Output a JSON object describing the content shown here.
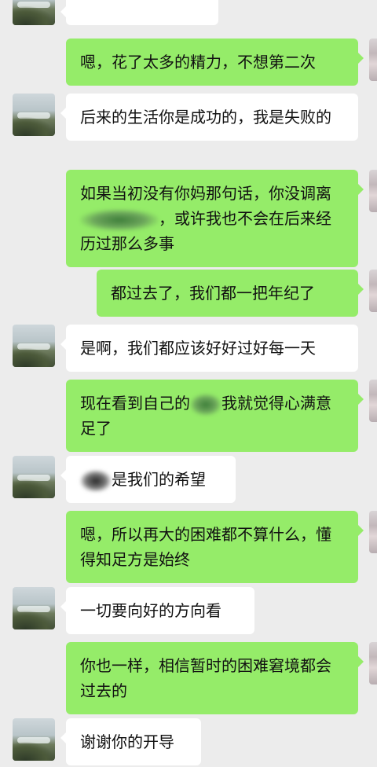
{
  "messages": [
    {
      "side": "in",
      "text": ""
    },
    {
      "side": "out",
      "text": "嗯，花了太多的精力，不想第二次"
    },
    {
      "side": "in",
      "text": "后来的生活你是成功的，我是失败的"
    },
    {
      "side": "out",
      "text_a": "如果当初没有你妈那句话，你没调离",
      "text_b": "，或许我也不会在后来经历过那么多事",
      "redacted": true
    },
    {
      "side": "out",
      "text": "都过去了，我们都一把年纪了"
    },
    {
      "side": "in",
      "text": "是啊，我们都应该好好过好每一天"
    },
    {
      "side": "out",
      "text_a": "现在看到自己的",
      "text_b": "我就觉得心满意足了",
      "redacted": true
    },
    {
      "side": "in",
      "text": "是我们的希望",
      "redacted": true
    },
    {
      "side": "out",
      "text": "嗯，所以再大的困难都不算什么，懂得知足方是始终"
    },
    {
      "side": "in",
      "text": "一切要向好的方向看"
    },
    {
      "side": "out",
      "text": "你也一样，相信暂时的困难窘境都会过去的"
    },
    {
      "side": "in",
      "text": "谢谢你的开导"
    }
  ],
  "colors": {
    "background": "#ececec",
    "incoming_bubble": "#ffffff",
    "outgoing_bubble": "#95ec69"
  },
  "icons": {
    "contact_avatar": "landscape-avatar-icon",
    "self_avatar": "user-avatar-icon"
  }
}
